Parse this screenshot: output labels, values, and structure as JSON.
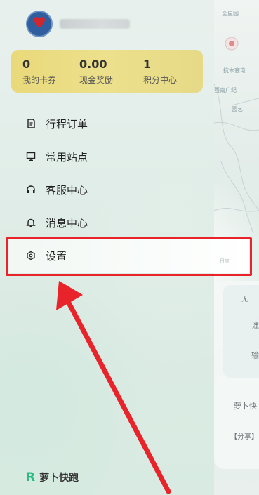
{
  "user": {
    "avatar": "heart-avatar"
  },
  "stats": [
    {
      "value": "0",
      "label": "我的卡券"
    },
    {
      "value": "0.00",
      "label": "现金奖励"
    },
    {
      "value": "1",
      "label": "积分中心"
    }
  ],
  "menu": {
    "items": [
      {
        "label": "行程订单",
        "icon": "document-icon"
      },
      {
        "label": "常用站点",
        "icon": "monitor-icon"
      },
      {
        "label": "客服中心",
        "icon": "headset-icon"
      },
      {
        "label": "消息中心",
        "icon": "bell-icon"
      },
      {
        "label": "设置",
        "icon": "hexagon-settings-icon"
      }
    ]
  },
  "brand": {
    "name": "萝卜快跑"
  },
  "background": {
    "map_labels": [
      "全星园",
      "抗木塞屯",
      "西南广纪",
      "园艺"
    ],
    "panel_texts": [
      "无",
      "谁",
      "输",
      "萝卜快",
      "【分享】"
    ],
    "baidu_watermark": "日度"
  },
  "colors": {
    "accent": "#2fb985",
    "card": "#e9d97a",
    "highlight": "#e8232a"
  }
}
